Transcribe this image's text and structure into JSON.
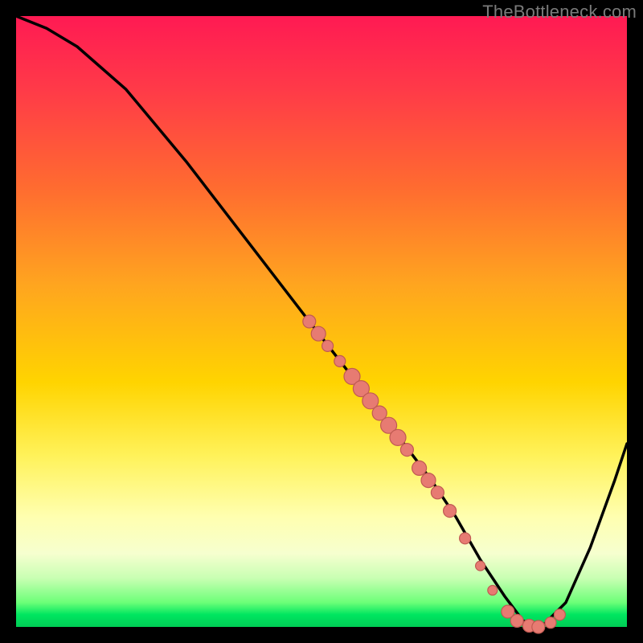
{
  "attribution": "TheBottleneck.com",
  "chart_data": {
    "type": "line",
    "title": "",
    "xlabel": "",
    "ylabel": "",
    "xlim": [
      0,
      100
    ],
    "ylim": [
      0,
      100
    ],
    "background_gradient": [
      "#ff1a53",
      "#ff6b30",
      "#ffd400",
      "#ffffb0",
      "#00cc55"
    ],
    "series": [
      {
        "name": "curve",
        "x": [
          0,
          5,
          10,
          18,
          28,
          38,
          48,
          55,
          62,
          68,
          72,
          76,
          80,
          83,
          86,
          90,
          94,
          98,
          100
        ],
        "y": [
          100,
          98,
          95,
          88,
          76,
          63,
          50,
          41,
          32,
          24,
          18,
          11,
          5,
          1,
          0,
          4,
          13,
          24,
          30
        ]
      }
    ],
    "markers": {
      "name": "bead-cluster",
      "color": "#e77b72",
      "points": [
        {
          "x": 48.0,
          "y": 50.0,
          "r": 8
        },
        {
          "x": 49.5,
          "y": 48.0,
          "r": 9
        },
        {
          "x": 51.0,
          "y": 46.0,
          "r": 7
        },
        {
          "x": 53.0,
          "y": 43.5,
          "r": 7
        },
        {
          "x": 55.0,
          "y": 41.0,
          "r": 10
        },
        {
          "x": 56.5,
          "y": 39.0,
          "r": 10
        },
        {
          "x": 58.0,
          "y": 37.0,
          "r": 10
        },
        {
          "x": 59.5,
          "y": 35.0,
          "r": 9
        },
        {
          "x": 61.0,
          "y": 33.0,
          "r": 10
        },
        {
          "x": 62.5,
          "y": 31.0,
          "r": 10
        },
        {
          "x": 64.0,
          "y": 29.0,
          "r": 8
        },
        {
          "x": 66.0,
          "y": 26.0,
          "r": 9
        },
        {
          "x": 67.5,
          "y": 24.0,
          "r": 9
        },
        {
          "x": 69.0,
          "y": 22.0,
          "r": 8
        },
        {
          "x": 71.0,
          "y": 19.0,
          "r": 8
        },
        {
          "x": 73.5,
          "y": 14.5,
          "r": 7
        },
        {
          "x": 76.0,
          "y": 10.0,
          "r": 6
        },
        {
          "x": 78.0,
          "y": 6.0,
          "r": 6
        },
        {
          "x": 80.5,
          "y": 2.5,
          "r": 8
        },
        {
          "x": 82.0,
          "y": 1.0,
          "r": 8
        },
        {
          "x": 84.0,
          "y": 0.2,
          "r": 8
        },
        {
          "x": 85.5,
          "y": 0.0,
          "r": 8
        },
        {
          "x": 87.5,
          "y": 0.7,
          "r": 7
        },
        {
          "x": 89.0,
          "y": 2.0,
          "r": 7
        }
      ]
    }
  }
}
